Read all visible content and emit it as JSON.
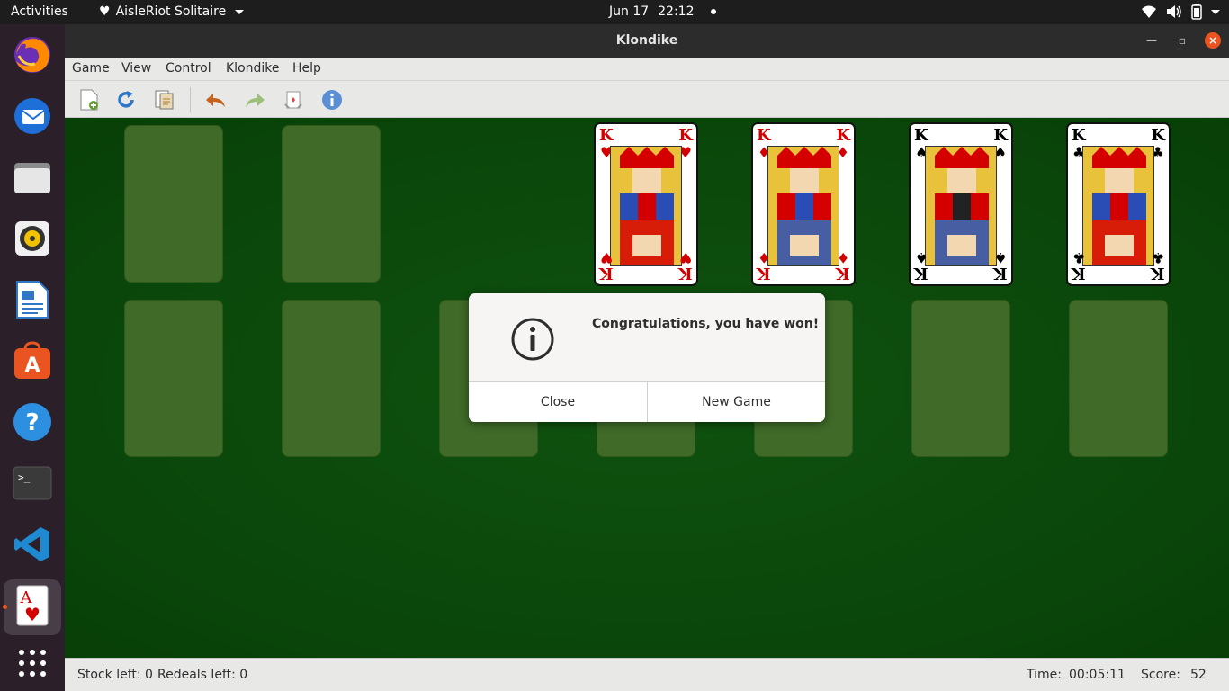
{
  "topbar": {
    "activities": "Activities",
    "app_name": "AisleRiot Solitaire",
    "date": "Jun 17",
    "time": "22:12",
    "tray_icons": [
      "wifi-icon",
      "volume-icon",
      "battery-icon",
      "power-menu-caret"
    ]
  },
  "dock": {
    "apps": [
      "firefox",
      "thunderbird",
      "files",
      "rhythmbox",
      "libreoffice-writer",
      "ubuntu-software",
      "help",
      "terminal",
      "vscode",
      "aisleriot-solitaire",
      "show-applications"
    ]
  },
  "window": {
    "title": "Klondike"
  },
  "menubar": {
    "items": [
      "Game",
      "View",
      "Control",
      "Klondike",
      "Help"
    ]
  },
  "toolbar": {
    "tools": [
      "new-game",
      "restart-game",
      "select-game",
      "undo",
      "redo",
      "hint",
      "about"
    ]
  },
  "foundations": [
    {
      "rank": "K",
      "suit": "♥",
      "color": "#d40000"
    },
    {
      "rank": "K",
      "suit": "♦",
      "color": "#d40000"
    },
    {
      "rank": "K",
      "suit": "♠",
      "color": "#000000"
    },
    {
      "rank": "K",
      "suit": "♣",
      "color": "#000000"
    }
  ],
  "dialog": {
    "message": "Congratulations, you have won!",
    "close_label": "Close",
    "new_game_label": "New Game"
  },
  "statusbar": {
    "stock": "Stock left: 0",
    "redeals": "Redeals left: 0",
    "time_label": "Time:",
    "time_value": "00:05:11",
    "score_label": "Score:",
    "score_value": "52"
  },
  "colors": {
    "felt": "#0c4a0c",
    "slot": "#3f6a28",
    "ubuntu_orange": "#e95420"
  }
}
